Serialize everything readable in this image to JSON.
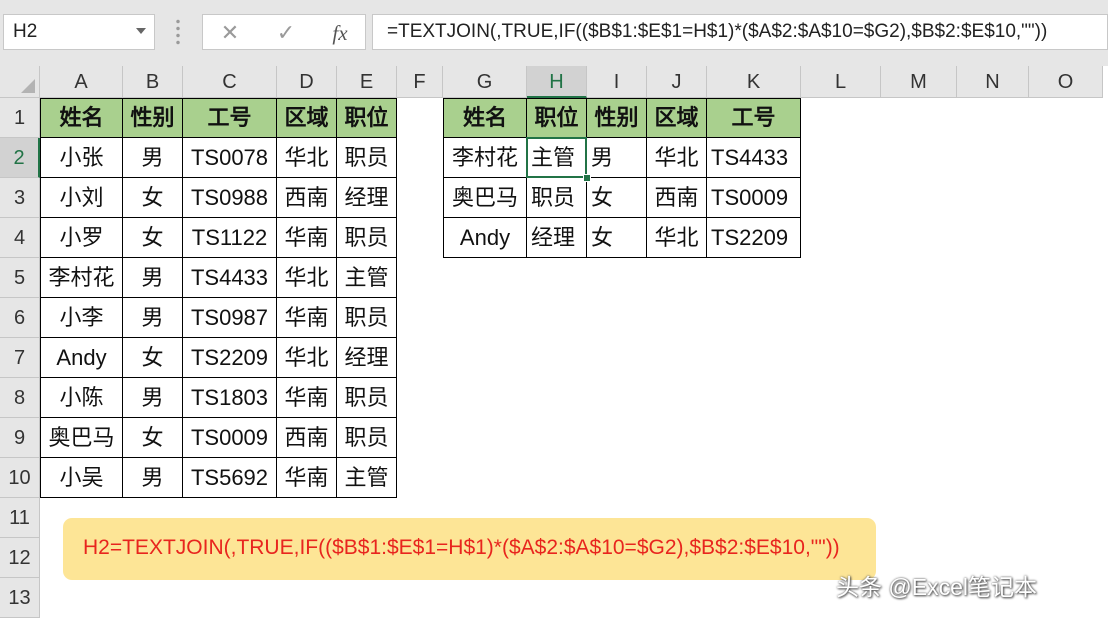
{
  "name_box": "H2",
  "formula_bar": {
    "cancel_icon": "x-mark-icon",
    "enter_icon": "check-mark-icon",
    "fx_label": "fx",
    "formula": "=TEXTJOIN(,TRUE,IF(($B$1:$E$1=H$1)*($A$2:$A$10=$G2),$B$2:$E$10,\"\"))"
  },
  "columns": [
    "A",
    "B",
    "C",
    "D",
    "E",
    "F",
    "G",
    "H",
    "I",
    "J",
    "K",
    "L",
    "M",
    "N",
    "O"
  ],
  "rows": [
    "1",
    "2",
    "3",
    "4",
    "5",
    "6",
    "7",
    "8",
    "9",
    "10",
    "11",
    "12",
    "13"
  ],
  "selected_cell": {
    "column": "H",
    "row": "2"
  },
  "source_table": {
    "headers": [
      "姓名",
      "性别",
      "工号",
      "区域",
      "职位"
    ],
    "rows": [
      [
        "小张",
        "男",
        "TS0078",
        "华北",
        "职员"
      ],
      [
        "小刘",
        "女",
        "TS0988",
        "西南",
        "经理"
      ],
      [
        "小罗",
        "女",
        "TS1122",
        "华南",
        "职员"
      ],
      [
        "李村花",
        "男",
        "TS4433",
        "华北",
        "主管"
      ],
      [
        "小李",
        "男",
        "TS0987",
        "华南",
        "职员"
      ],
      [
        "Andy",
        "女",
        "TS2209",
        "华北",
        "经理"
      ],
      [
        "小陈",
        "男",
        "TS1803",
        "华南",
        "职员"
      ],
      [
        "奥巴马",
        "女",
        "TS0009",
        "西南",
        "职员"
      ],
      [
        "小吴",
        "男",
        "TS5692",
        "华南",
        "主管"
      ]
    ]
  },
  "result_table": {
    "headers": [
      "姓名",
      "职位",
      "性别",
      "区域",
      "工号"
    ],
    "rows": [
      [
        "李村花",
        "主管",
        "男",
        "华北",
        "TS4433"
      ],
      [
        "奥巴马",
        "职员",
        "女",
        "西南",
        "TS0009"
      ],
      [
        "Andy",
        "经理",
        "女",
        "华北",
        "TS2209"
      ]
    ]
  },
  "note": "H2=TEXTJOIN(,TRUE,IF(($B$1:$E$1=H$1)*($A$2:$A$10=$G2),$B$2:$E$10,\"\"))",
  "watermark": "头条 @Excel笔记本",
  "colors": {
    "header_fill": "#a9d08e",
    "note_fill": "#fde596",
    "note_text": "#e8251e",
    "selection": "#217346"
  }
}
